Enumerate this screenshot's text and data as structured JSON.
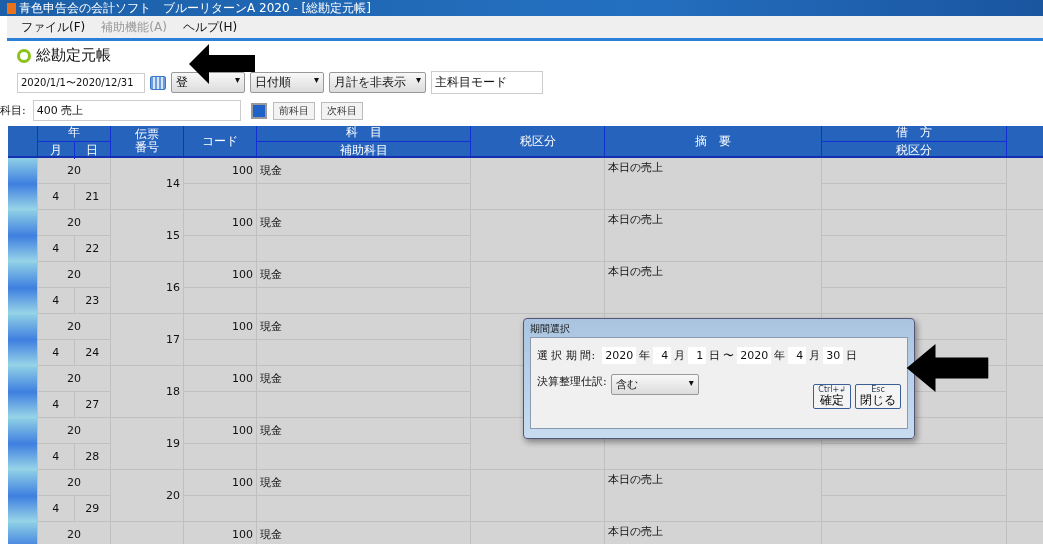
{
  "window": {
    "title": "青色申告会の会計ソフト　ブルーリターンA 2020 - [総勘定元帳]"
  },
  "menu": [
    {
      "label": "ファイル(F)",
      "disabled": false
    },
    {
      "label": "補助機能(A)",
      "disabled": true
    },
    {
      "label": "ヘルプ(H)",
      "disabled": false
    }
  ],
  "page_title": "総勘定元帳",
  "toolbar": {
    "period": "2020/1/1〜2020/12/31",
    "dropdowns": [
      {
        "label": "登",
        "caret": "▾"
      },
      {
        "label": "日付順",
        "caret": "▾"
      },
      {
        "label": "月計を非表示",
        "caret": "▾"
      }
    ],
    "mode": "主科目モード"
  },
  "account": {
    "label": "科目:",
    "value": "400  売上",
    "buttons": [
      "前科目",
      "次科目"
    ]
  },
  "table": {
    "header_top": [
      "年",
      "伝票番号",
      "コード",
      "科　目",
      "税区分",
      "摘　要",
      "借　方"
    ],
    "header_sub": [
      "月",
      "日",
      "補助科目",
      "税区分"
    ],
    "rows": [
      {
        "year": "20",
        "month": "4",
        "day": "21",
        "slip": "14",
        "code": "100",
        "account": "現金",
        "summary": "本日の売上"
      },
      {
        "year": "20",
        "month": "4",
        "day": "22",
        "slip": "15",
        "code": "100",
        "account": "現金",
        "summary": "本日の売上"
      },
      {
        "year": "20",
        "month": "4",
        "day": "23",
        "slip": "16",
        "code": "100",
        "account": "現金",
        "summary": "本日の売上"
      },
      {
        "year": "20",
        "month": "4",
        "day": "24",
        "slip": "17",
        "code": "100",
        "account": "現金"
      },
      {
        "year": "20",
        "month": "4",
        "day": "27",
        "slip": "18",
        "code": "100",
        "account": "現金"
      },
      {
        "year": "20",
        "month": "4",
        "day": "28",
        "slip": "19",
        "code": "100",
        "account": "現金"
      },
      {
        "year": "20",
        "month": "4",
        "day": "29",
        "slip": "20",
        "code": "100",
        "account": "現金",
        "summary": "本日の売上"
      },
      {
        "year": "20",
        "code": "100",
        "account": "現金",
        "summary": "本日の売上"
      }
    ]
  },
  "dialog": {
    "title": "期間選択",
    "period_label": "選 択 期 間:",
    "dates": [
      {
        "year": "2020",
        "year_unit": "年",
        "month": "4",
        "month_unit": "月",
        "day": "1",
        "day_unit": "日"
      },
      {
        "year": "2020",
        "year_unit": "年",
        "month": "4",
        "month_unit": "月",
        "day": "30",
        "day_unit": "日"
      }
    ],
    "tilde": "〜",
    "closing_label": "決算整理仕訳:",
    "closing_value": "含む",
    "closing_caret": "▾",
    "buttons": [
      {
        "key": "Ctrl+↲",
        "label": "確定"
      },
      {
        "key": "Esc",
        "label": "閉じる"
      }
    ]
  }
}
